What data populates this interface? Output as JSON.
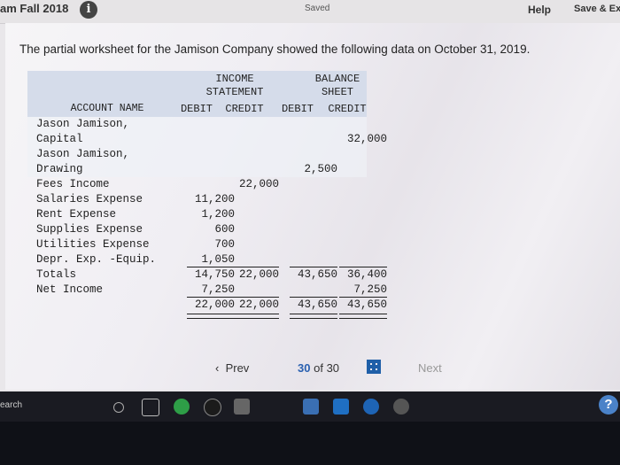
{
  "topbar": {
    "exam_title": "am Fall 2018",
    "saved_label": "Saved",
    "help_label": "Help",
    "save_exit_label": "Save & Ex"
  },
  "question_text": "The partial worksheet for the Jamison Company showed the following data on October 31, 2019.",
  "worksheet": {
    "headers": {
      "income_statement": "INCOME\nSTATEMENT",
      "balance_sheet": "BALANCE\nSHEET",
      "account_name": "ACCOUNT NAME",
      "is_debit": "DEBIT",
      "is_credit": "CREDIT",
      "bs_debit": "DEBIT",
      "bs_credit": "CREDIT"
    },
    "rows": [
      {
        "name": "Jason Jamison,\nCapital",
        "is_debit": "",
        "is_credit": "",
        "bs_debit": "",
        "bs_credit": "32,000"
      },
      {
        "name": "Jason Jamison,\nDrawing",
        "is_debit": "",
        "is_credit": "",
        "bs_debit": "2,500",
        "bs_credit": ""
      },
      {
        "name": "Fees Income",
        "is_debit": "",
        "is_credit": "22,000",
        "bs_debit": "",
        "bs_credit": ""
      },
      {
        "name": "Salaries Expense",
        "is_debit": "11,200",
        "is_credit": "",
        "bs_debit": "",
        "bs_credit": ""
      },
      {
        "name": "Rent Expense",
        "is_debit": "1,200",
        "is_credit": "",
        "bs_debit": "",
        "bs_credit": ""
      },
      {
        "name": "Supplies Expense",
        "is_debit": "600",
        "is_credit": "",
        "bs_debit": "",
        "bs_credit": ""
      },
      {
        "name": "Utilities Expense",
        "is_debit": "700",
        "is_credit": "",
        "bs_debit": "",
        "bs_credit": ""
      },
      {
        "name": "Depr. Exp. -Equip.",
        "is_debit": "1,050",
        "is_credit": "",
        "bs_debit": "",
        "bs_credit": ""
      },
      {
        "name": "Totals",
        "is_debit": "14,750",
        "is_credit": "22,000",
        "bs_debit": "43,650",
        "bs_credit": "36,400"
      },
      {
        "name": "Net Income",
        "is_debit": "7,250",
        "is_credit": "",
        "bs_debit": "",
        "bs_credit": "7,250"
      },
      {
        "name": "",
        "is_debit": "22,000",
        "is_credit": "22,000",
        "bs_debit": "43,650",
        "bs_credit": "43,650"
      }
    ]
  },
  "pager": {
    "prev_label": "Prev",
    "current": "30",
    "of_label": "of",
    "total": "30",
    "next_label": "Next"
  },
  "taskbar": {
    "search_label": "earch",
    "help_glyph": "?"
  }
}
